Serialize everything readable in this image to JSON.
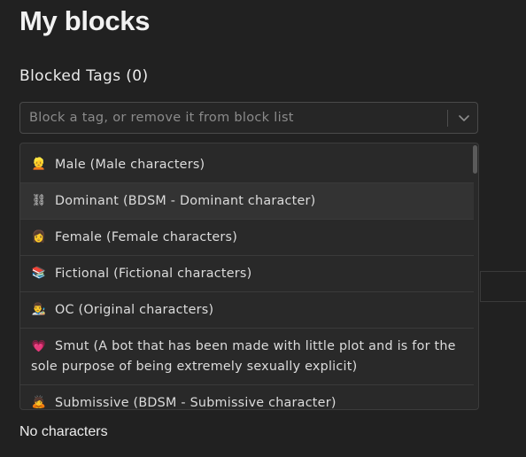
{
  "page": {
    "title": "My blocks",
    "section_heading": "Blocked Tags (0)",
    "empty_state": "No characters"
  },
  "select": {
    "placeholder": "Block a tag, or remove it from block list",
    "chevron_icon": "chevron-down-icon"
  },
  "menu": {
    "options": [
      {
        "emoji": "👱",
        "label": "Male (Male characters)"
      },
      {
        "emoji": "⛓",
        "label": "Dominant (BDSM - Dominant character)"
      },
      {
        "emoji": "👩",
        "label": "Female (Female characters)"
      },
      {
        "emoji": "📚",
        "label": "Fictional (Fictional characters)"
      },
      {
        "emoji": "👨‍🎨",
        "label": "OC (Original characters)"
      },
      {
        "emoji": "💗",
        "label": "Smut (A bot that has been made with little plot and is for the sole purpose of being extremely sexually explicit)"
      },
      {
        "emoji": "🙇",
        "label": "Submissive (BDSM - Submissive character)"
      }
    ]
  },
  "colors": {
    "background": "#212121",
    "menu_background": "#292929",
    "hover_background": "#333333"
  }
}
